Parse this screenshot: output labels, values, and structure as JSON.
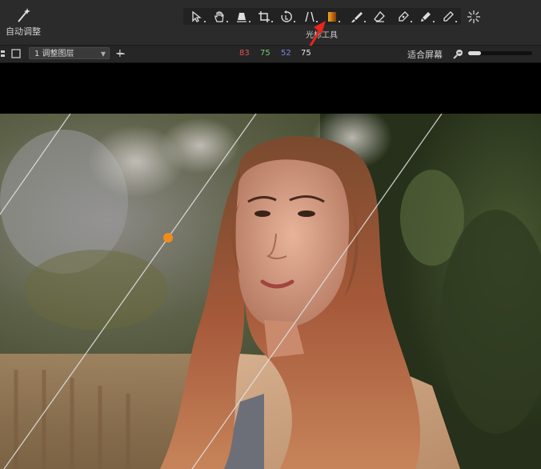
{
  "toolbar": {
    "auto_adjust_label": "自动调整",
    "tool_group_label": "光标工具",
    "tools": [
      {
        "name": "pointer-select-icon"
      },
      {
        "name": "pan-hand-icon"
      },
      {
        "name": "keystone-icon"
      },
      {
        "name": "crop-icon"
      },
      {
        "name": "rotate-icon"
      },
      {
        "name": "straighten-icon"
      },
      {
        "name": "gradient-mask-icon",
        "active": true
      },
      {
        "name": "brush-icon"
      },
      {
        "name": "eraser-icon"
      },
      {
        "name": "pen-icon"
      },
      {
        "name": "clone-brush-icon"
      },
      {
        "name": "eyedropper-icon"
      }
    ],
    "extra_tool": "sparkle-icon"
  },
  "subbar": {
    "layer_select_value": "1 调整图层",
    "readout": {
      "r": "83",
      "g": "75",
      "b": "52",
      "a": "75"
    },
    "readout_colors": {
      "r": "#e05555",
      "g": "#6fcf6f",
      "b": "#7a86e6",
      "a": "#e8e8e8"
    },
    "fit_label": "适合屏幕",
    "zoom_level": 0.2
  },
  "colors": {
    "accent": "#f08c1e",
    "arrow": "#e8261c"
  }
}
